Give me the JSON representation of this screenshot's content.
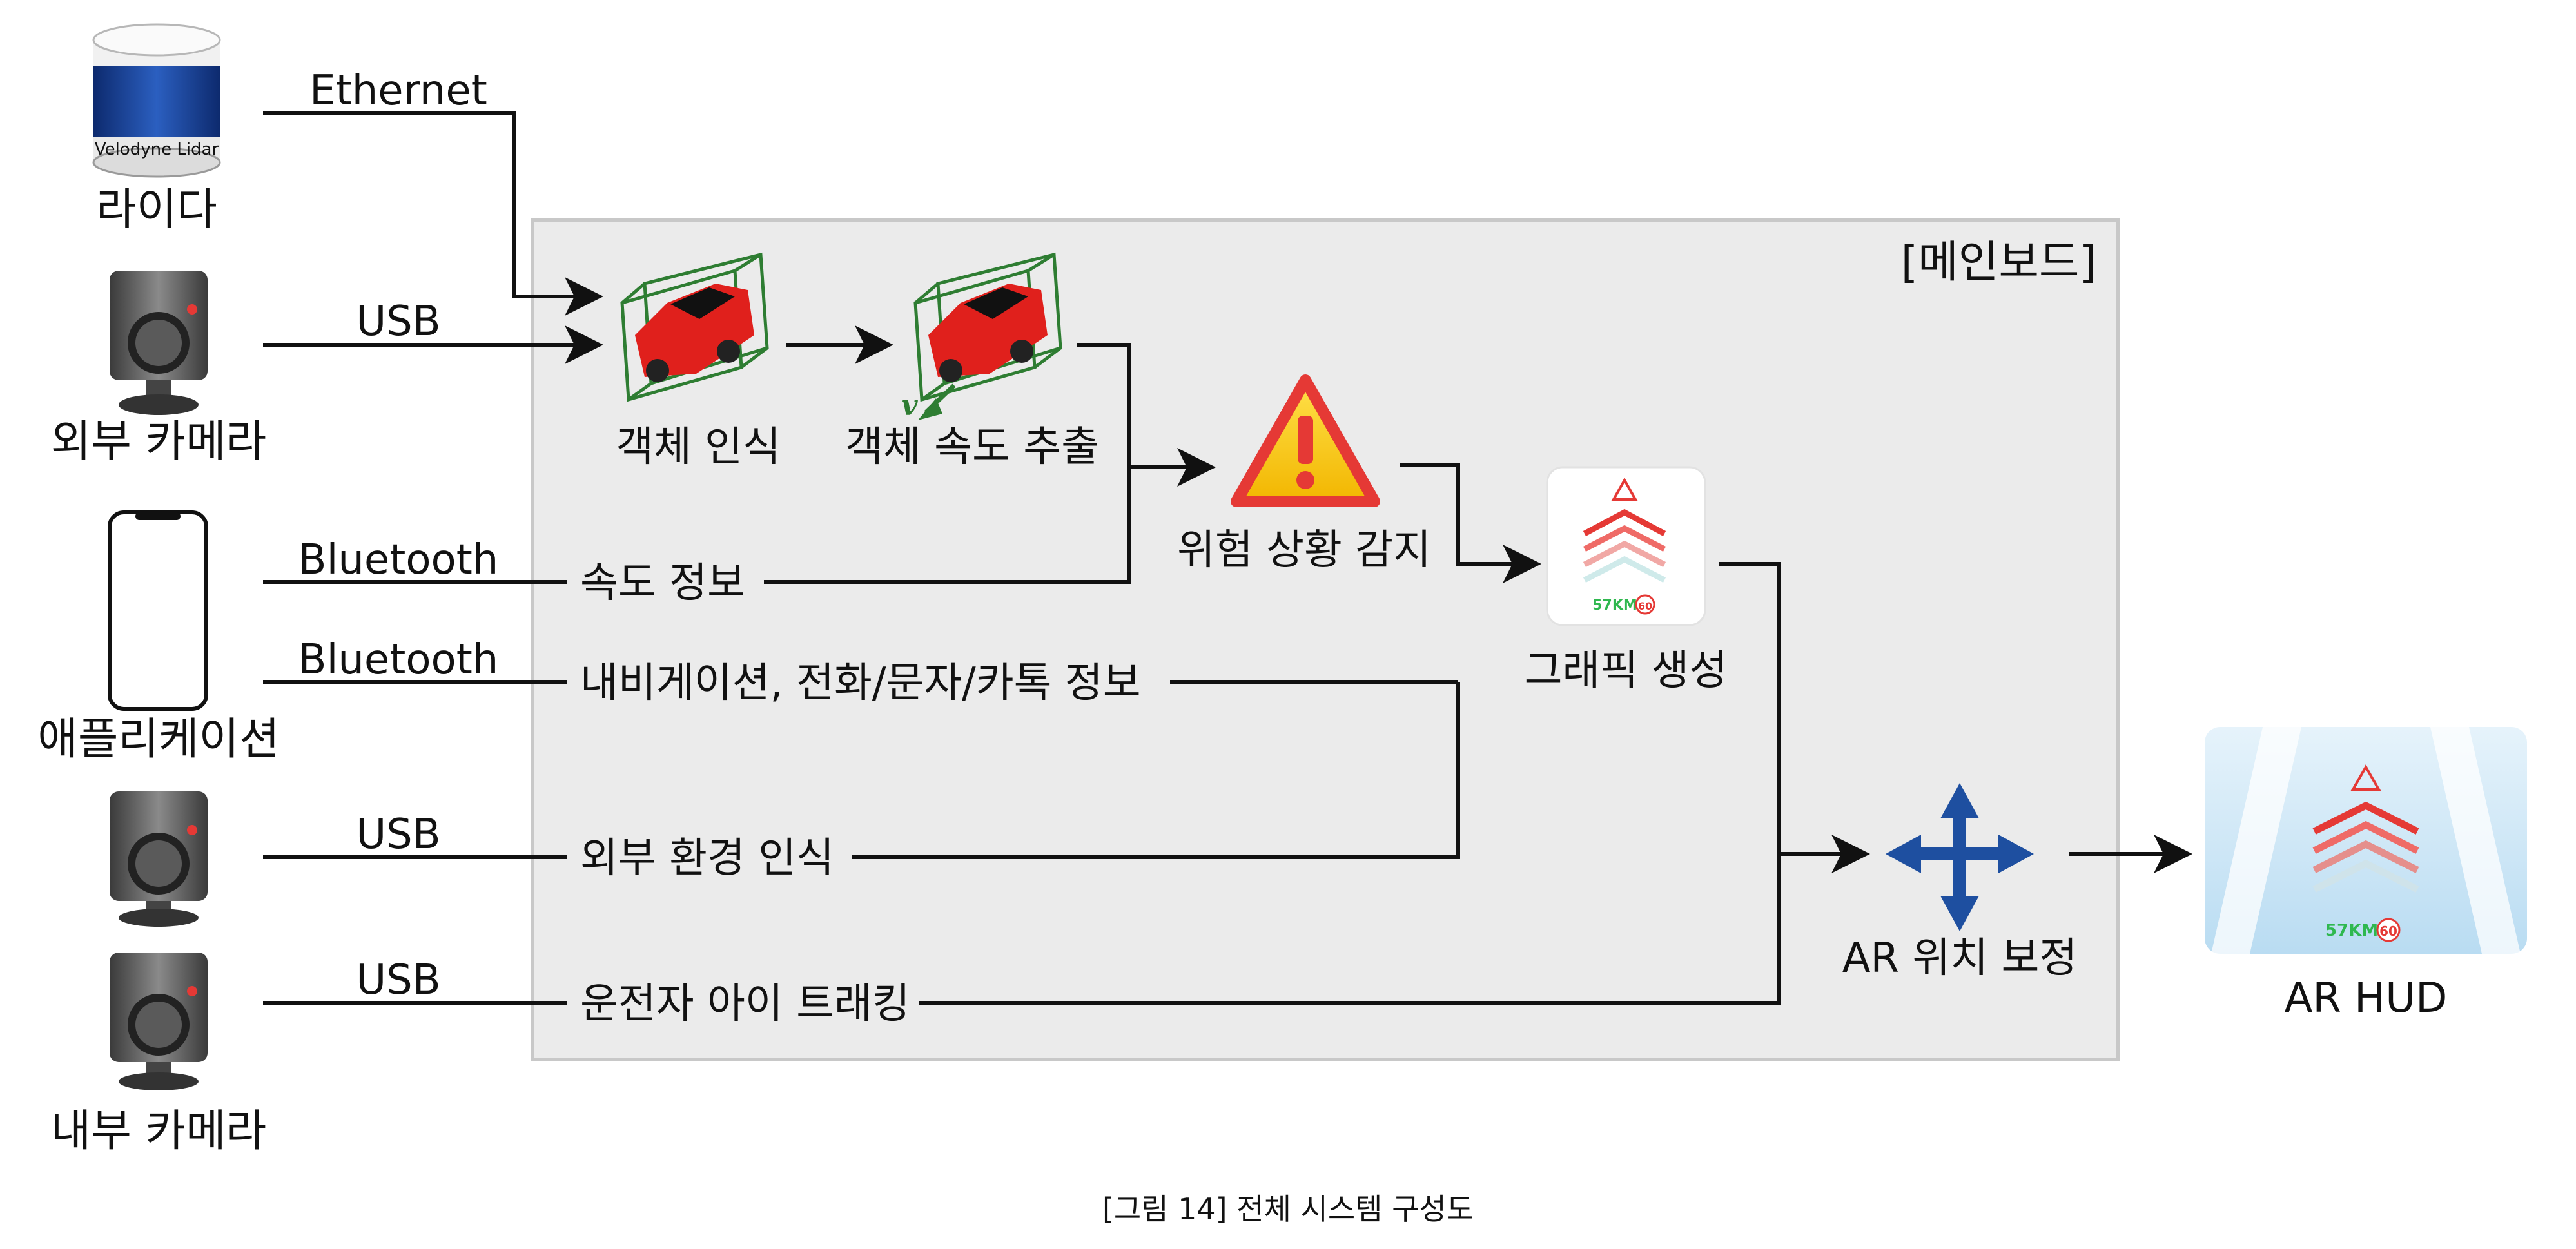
{
  "mainboard": {
    "title": "[메인보드]"
  },
  "devices": {
    "lidar": {
      "label": "라이다",
      "brand": "Velodyne Lidar",
      "link": "Ethernet"
    },
    "ext_camera": {
      "label": "외부 카메라",
      "link": "USB"
    },
    "app": {
      "label": "애플리케이션",
      "link1": "Bluetooth",
      "link2": "Bluetooth"
    },
    "camera3": {
      "link": "USB"
    },
    "int_camera": {
      "label": "내부 카메라",
      "link": "USB"
    }
  },
  "stages": {
    "detect": "객체 인식",
    "speed": "객체 속도 추출",
    "velocity_symbol": "v",
    "hazard": "위험 상황 감지",
    "graphic": "그래픽 생성",
    "ar_correct": "AR 위치 보정",
    "ar_hud": "AR HUD"
  },
  "inputs": {
    "speed_info": "속도 정보",
    "nav_info": "내비게이션, 전화/문자/카톡 정보",
    "env_recog": "외부 환경 인식",
    "eye_track": "운전자 아이 트래킹"
  },
  "hud": {
    "speed_text": "57KM",
    "limit_text": "60"
  },
  "caption": "[그림 14] 전체 시스템 구성도",
  "colors": {
    "board_fill": "#ebebeb",
    "board_stroke": "#c8c8c8",
    "car_red": "#e0201c",
    "box_green": "#2e7d32",
    "warning_yellow": "#f5c400",
    "warning_red": "#e53935",
    "move_blue": "#1e4fa0",
    "hud_green": "#2fb84f"
  }
}
